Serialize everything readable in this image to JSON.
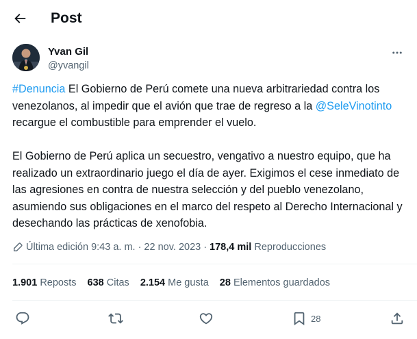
{
  "header": {
    "title": "Post"
  },
  "author": {
    "name": "Yvan Gil",
    "handle": "@yvangil"
  },
  "tweet": {
    "p1_tag": "#Denuncia",
    "p1_a": " El Gobierno de Perú comete una nueva arbitrariedad contra los venezolanos, al impedir que el avión que trae de regreso a la ",
    "p1_mention": "@SeleVinotinto",
    "p1_b": " recargue el combustible para emprender el vuelo.",
    "p2": "El Gobierno de Perú aplica un secuestro, vengativo a nuestro equipo, que ha realizado un extraordinario juego el día de ayer. Exigimos el cese inmediato de las agresiones en contra de nuestra selección y del pueblo venezolano, asumiendo sus obligaciones en el marco del respeto al Derecho Internacional y desechando las prácticas de xenofobia."
  },
  "meta": {
    "edited": "Última edición 9:43 a. m.",
    "sep": "·",
    "date": "22 nov. 2023",
    "views_count": "178,4 mil",
    "views_label": "Reproducciones"
  },
  "stats": [
    {
      "count": "1.901",
      "label": "Reposts"
    },
    {
      "count": "638",
      "label": "Citas"
    },
    {
      "count": "2.154",
      "label": "Me gusta"
    },
    {
      "count": "28",
      "label": "Elementos guardados"
    }
  ],
  "actions": {
    "bookmark_count": "28"
  },
  "icons": {
    "back": "arrow-left-icon",
    "more": "more-dots-icon",
    "edit": "pencil-icon",
    "reply": "reply-icon",
    "repost": "repost-icon",
    "like": "heart-icon",
    "bookmark": "bookmark-icon",
    "share": "share-icon"
  },
  "colors": {
    "link": "#1d9bf0",
    "text": "#0f1419",
    "secondary": "#536471",
    "divider": "#eff3f4"
  }
}
